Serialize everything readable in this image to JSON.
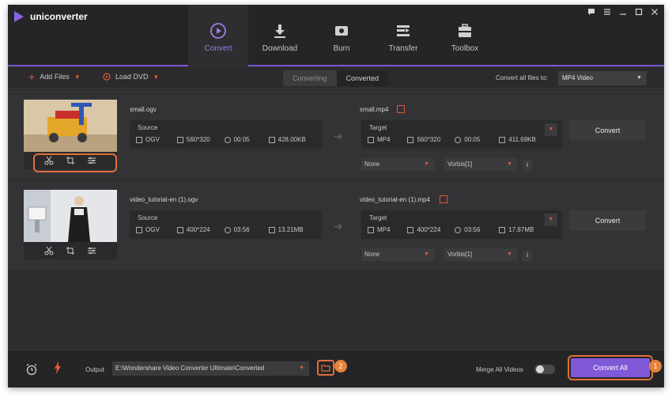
{
  "app": {
    "name": "uniconverter",
    "brand_color": "#8a64e0",
    "accent": "#e0593a"
  },
  "window_controls": [
    "chat-icon",
    "menu-icon",
    "minimize-icon",
    "maximize-icon",
    "close-icon"
  ],
  "nav": [
    {
      "label": "Convert",
      "icon": "convert-icon",
      "active": true
    },
    {
      "label": "Download",
      "icon": "download-icon",
      "active": false
    },
    {
      "label": "Burn",
      "icon": "burn-icon",
      "active": false
    },
    {
      "label": "Transfer",
      "icon": "transfer-icon",
      "active": false
    },
    {
      "label": "Toolbox",
      "icon": "toolbox-icon",
      "active": false
    }
  ],
  "toolbar": {
    "add_files": "Add Files",
    "load_dvd": "Load DVD",
    "tab_converting": "Converting",
    "tab_converted": "Converted",
    "convert_all_to_label": "Convert all files to:",
    "convert_all_to_value": "MP4 Video"
  },
  "files": [
    {
      "source_name": "small.ogv",
      "source": {
        "label": "Source",
        "format": "OGV",
        "resolution": "560*320",
        "duration": "00:05",
        "size": "428.00KB"
      },
      "target_name": "small.mp4",
      "target": {
        "label": "Target",
        "format": "MP4",
        "resolution": "560*320",
        "duration": "00:05",
        "size": "411.69KB"
      },
      "subtitle": "None",
      "audio": "Vorbis[1]",
      "convert_label": "Convert",
      "info_label": "i"
    },
    {
      "source_name": "video_tutorial-en (1).ogv",
      "source": {
        "label": "Source",
        "format": "OGV",
        "resolution": "400*224",
        "duration": "03:56",
        "size": "13.21MB"
      },
      "target_name": "video_tutorial-en (1).mp4",
      "target": {
        "label": "Target",
        "format": "MP4",
        "resolution": "400*224",
        "duration": "03:56",
        "size": "17.87MB"
      },
      "subtitle": "None",
      "audio": "Vorbis[1]",
      "convert_label": "Convert",
      "info_label": "i"
    }
  ],
  "bottom": {
    "output_label": "Output",
    "output_path": "E:\\Wondershare Video Converter Ultimate\\Converted",
    "merge_label": "Merge All Videos",
    "merge_on": false,
    "convert_all_label": "Convert All",
    "badge_1": "1",
    "badge_2": "2"
  }
}
